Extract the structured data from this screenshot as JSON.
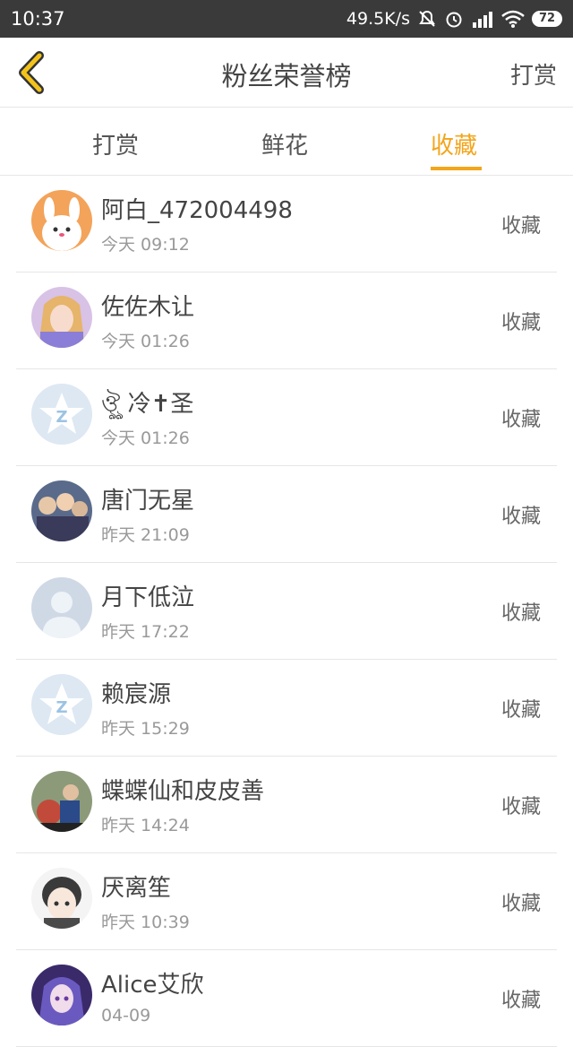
{
  "status_bar": {
    "time": "10:37",
    "net_speed": "49.5K/s",
    "battery": "72",
    "icons": [
      "mute-icon",
      "alarm-icon",
      "signal-icon",
      "wifi-icon",
      "battery-icon"
    ]
  },
  "header": {
    "title": "粉丝荣誉榜",
    "right_action": "打赏",
    "back_icon": "chevron-left-icon"
  },
  "tabs": [
    {
      "label": "打赏",
      "active": false
    },
    {
      "label": "鲜花",
      "active": false
    },
    {
      "label": "收藏",
      "active": true
    }
  ],
  "colors": {
    "accent": "#f3a51c",
    "status_bar": "#3a3a3a"
  },
  "fans": [
    {
      "name": "阿白_472004498",
      "time": "今天 09:12",
      "action": "收藏",
      "avatar": "bunny-avatar"
    },
    {
      "name": "佐佐木让",
      "time": "今天 01:26",
      "action": "收藏",
      "avatar": "anime-girl-avatar"
    },
    {
      "name": "ঔৣ 冷✝圣",
      "time": "今天 01:26",
      "action": "收藏",
      "avatar": "qq-default-avatar"
    },
    {
      "name": "唐门无星",
      "time": "昨天 21:09",
      "action": "收藏",
      "avatar": "anime-group-avatar"
    },
    {
      "name": "月下低泣",
      "time": "昨天 17:22",
      "action": "收藏",
      "avatar": "default-person-avatar"
    },
    {
      "name": "赖宸源",
      "time": "昨天 15:29",
      "action": "收藏",
      "avatar": "qq-default-avatar"
    },
    {
      "name": "蝶蝶仙和皮皮善",
      "time": "昨天 14:24",
      "action": "收藏",
      "avatar": "photo-avatar"
    },
    {
      "name": "厌离笙",
      "time": "昨天 10:39",
      "action": "收藏",
      "avatar": "chibi-avatar"
    },
    {
      "name": "Alice艾欣",
      "time": "04-09",
      "action": "收藏",
      "avatar": "anime-purple-avatar"
    }
  ]
}
